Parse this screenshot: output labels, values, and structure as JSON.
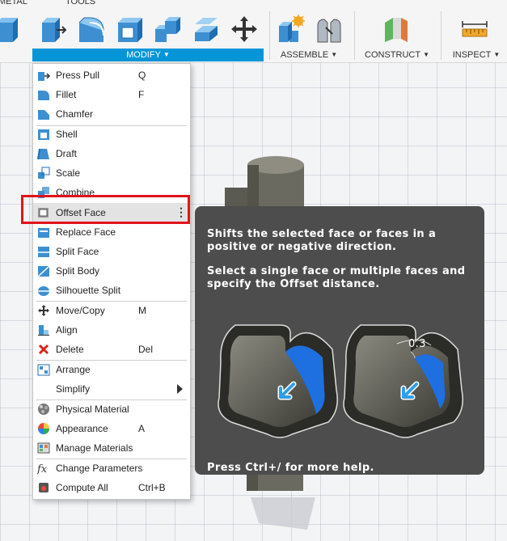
{
  "toolbar": {
    "tabs": [
      "METAL",
      "TOOLS"
    ],
    "groups": [
      {
        "label": "MODIFY",
        "caret": "▼"
      },
      {
        "label": "ASSEMBLE",
        "caret": "▼"
      },
      {
        "label": "CONSTRUCT",
        "caret": "▼"
      },
      {
        "label": "INSPECT",
        "caret": "▼"
      }
    ],
    "accent_color": "#0696d7"
  },
  "menu": {
    "items": [
      {
        "label": "Press Pull",
        "shortcut": "Q",
        "icon": "press-pull-icon"
      },
      {
        "label": "Fillet",
        "shortcut": "F",
        "icon": "fillet-icon"
      },
      {
        "label": "Chamfer",
        "shortcut": "",
        "icon": "chamfer-icon"
      },
      {
        "label": "Shell",
        "shortcut": "",
        "icon": "shell-icon"
      },
      {
        "label": "Draft",
        "shortcut": "",
        "icon": "draft-icon"
      },
      {
        "label": "Scale",
        "shortcut": "",
        "icon": "scale-icon"
      },
      {
        "label": "Combine",
        "shortcut": "",
        "icon": "combine-icon"
      },
      {
        "label": "Offset Face",
        "shortcut": "⋮",
        "icon": "offset-face-icon"
      },
      {
        "label": "Replace Face",
        "shortcut": "",
        "icon": "replace-face-icon"
      },
      {
        "label": "Split Face",
        "shortcut": "",
        "icon": "split-face-icon"
      },
      {
        "label": "Split Body",
        "shortcut": "",
        "icon": "split-body-icon"
      },
      {
        "label": "Silhouette Split",
        "shortcut": "",
        "icon": "silhouette-split-icon"
      },
      {
        "label": "Move/Copy",
        "shortcut": "M",
        "icon": "move-copy-icon"
      },
      {
        "label": "Align",
        "shortcut": "",
        "icon": "align-icon"
      },
      {
        "label": "Delete",
        "shortcut": "Del",
        "icon": "delete-icon"
      },
      {
        "label": "Arrange",
        "shortcut": "",
        "icon": "arrange-icon"
      },
      {
        "label": "Simplify",
        "shortcut": "",
        "icon": "submenu-arrow-icon"
      },
      {
        "label": "Physical Material",
        "shortcut": "",
        "icon": "physical-material-icon"
      },
      {
        "label": "Appearance",
        "shortcut": "A",
        "icon": "appearance-icon"
      },
      {
        "label": "Manage Materials",
        "shortcut": "",
        "icon": "manage-materials-icon"
      },
      {
        "label": "Change Parameters",
        "shortcut": "",
        "icon": "fx-icon"
      },
      {
        "label": "Compute All",
        "shortcut": "Ctrl+B",
        "icon": "compute-all-icon"
      }
    ],
    "highlighted_item": "Offset Face",
    "highlight_color": "#e0141b"
  },
  "tooltip": {
    "description": "Shifts the selected face or faces in a positive or negative direction.",
    "instruction": "Select a single face or multiple faces and specify the Offset distance.",
    "dimension_value": "0.3",
    "footer": "Press Ctrl+/ for more help."
  }
}
